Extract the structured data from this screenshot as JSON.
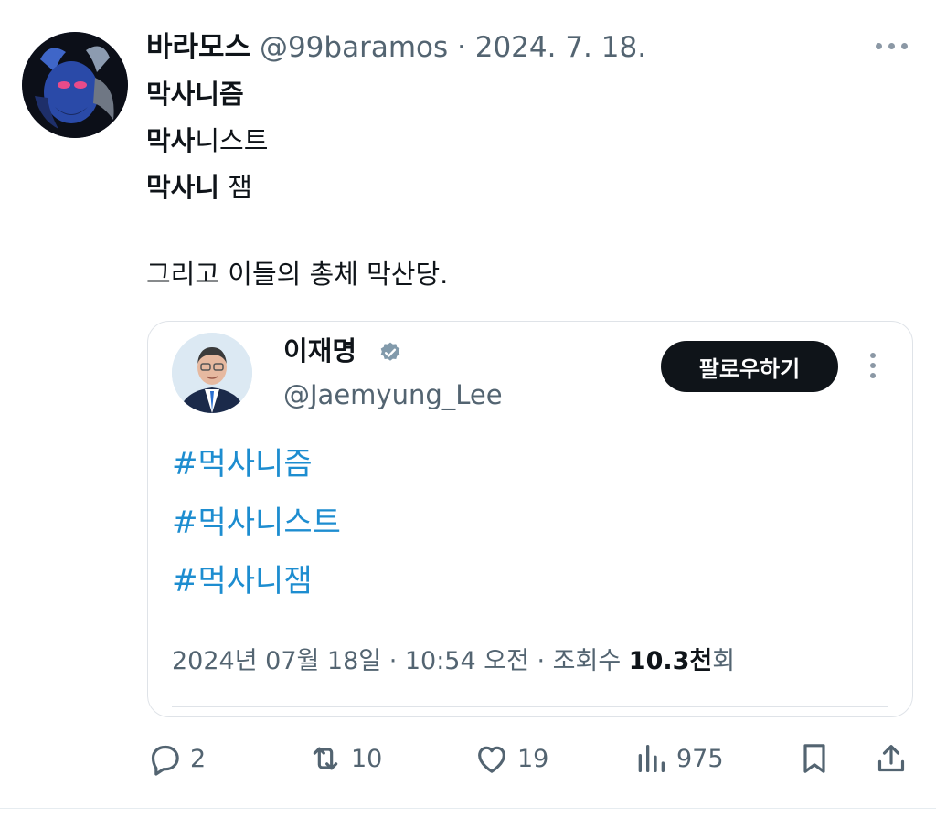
{
  "tweet": {
    "author_name": "바라모스",
    "author_handle": "@99baramos",
    "separator": "·",
    "date": "2024. 7. 18.",
    "lines": [
      {
        "bold": "막사니즘",
        "rest": ""
      },
      {
        "bold": "막사",
        "rest": "니스트"
      },
      {
        "bold": "막사니",
        "rest": " 잼"
      }
    ],
    "closing": "그리고 이들의 총체 막산당."
  },
  "quote": {
    "author_name": "이재명",
    "author_handle": "@Jaemyung_Lee",
    "follow_label": "팔로우하기",
    "hashtags": [
      "#먹사니즘",
      "#먹사니스트",
      "#먹사니잼"
    ],
    "footer_date": "2024년 07월 18일 · 10:54 오전 · 조회수 ",
    "footer_views": "10.3천",
    "footer_suffix": "회"
  },
  "actions": {
    "reply_count": "2",
    "retweet_count": "10",
    "like_count": "19",
    "views_count": "975"
  },
  "icons": [
    "reply-icon",
    "retweet-icon",
    "like-icon",
    "views-icon",
    "bookmark-icon",
    "share-icon",
    "verified-icon",
    "more-icon"
  ],
  "colors": {
    "hashtag": "#1d8dd0",
    "secondary_text": "#536471",
    "follow_button": "#0f1419",
    "verified": "#829aab"
  }
}
